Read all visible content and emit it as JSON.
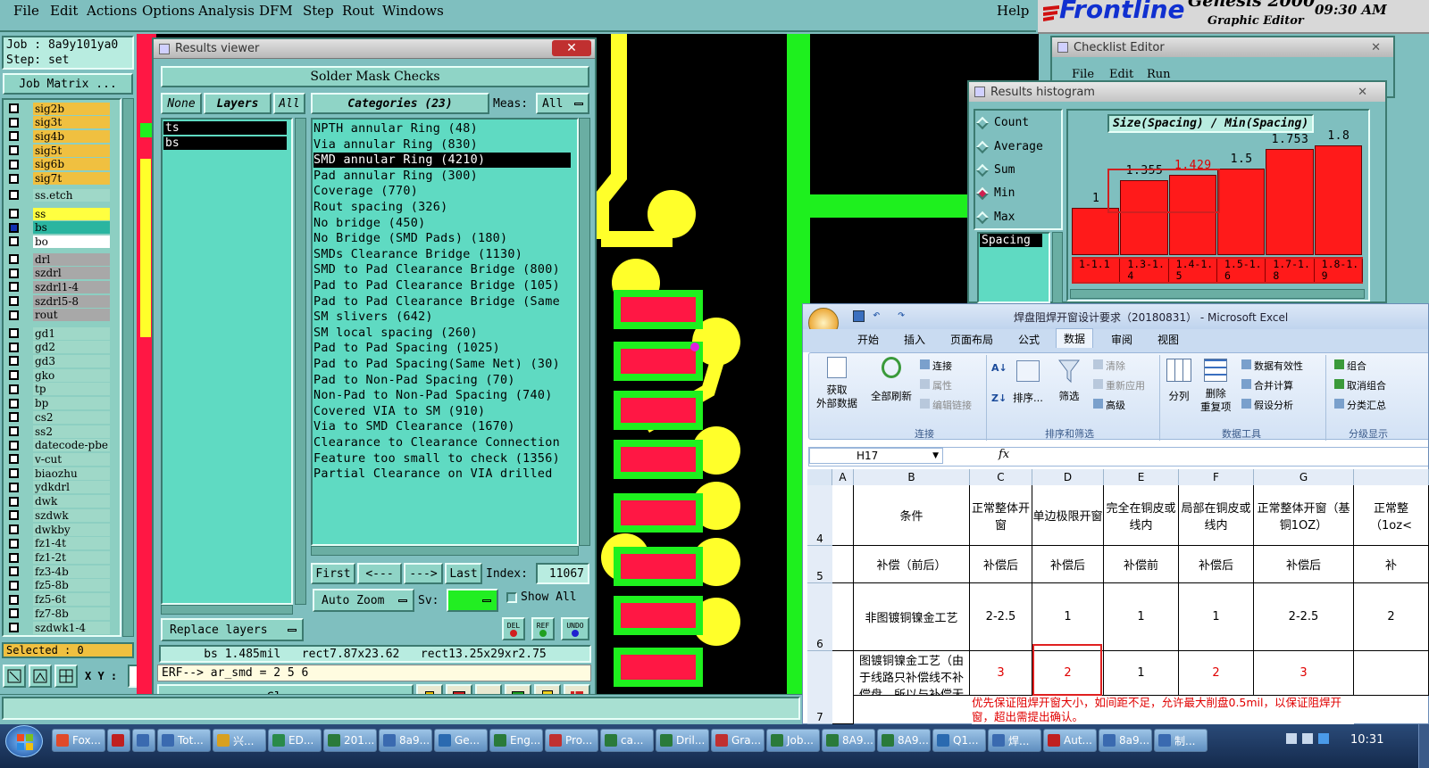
{
  "menu": {
    "items": [
      "File",
      "Edit",
      "Actions",
      "Options",
      "Analysis",
      "DFM",
      "Step",
      "Rout",
      "Windows"
    ],
    "help": "Help"
  },
  "brand": {
    "logo": "Frontline",
    "product": "Genesis 2000",
    "subtitle": "Graphic Editor",
    "clock": "09:30 AM"
  },
  "job": {
    "job_line": "Job : 8a9y101ya0",
    "step_line": "Step: set",
    "matrix_button": "Job Matrix ..."
  },
  "layers": {
    "group1": [
      {
        "name": "sig2b",
        "color": "#f0c040"
      },
      {
        "name": "sig3t",
        "color": "#f0c040"
      },
      {
        "name": "sig4b",
        "color": "#f0c040"
      },
      {
        "name": "sig5t",
        "color": "#f0c040"
      },
      {
        "name": "sig6b",
        "color": "#f0c040"
      },
      {
        "name": "sig7t",
        "color": "#f0c040"
      }
    ],
    "group2": [
      {
        "name": "ss.etch",
        "color": "#9fd8c8"
      }
    ],
    "group3": [
      {
        "name": "ss",
        "color": "#ffff40"
      },
      {
        "name": "bs",
        "color": "#2ab5a0"
      },
      {
        "name": "bo",
        "color": "#ffffff"
      }
    ],
    "group4": [
      {
        "name": "drl",
        "color": "#a8a8a8"
      },
      {
        "name": "szdrl",
        "color": "#a8a8a8"
      },
      {
        "name": "szdrl1-4",
        "color": "#a8a8a8"
      },
      {
        "name": "szdrl5-8",
        "color": "#a8a8a8"
      },
      {
        "name": "rout",
        "color": "#a8a8a8"
      }
    ],
    "group5": [
      {
        "name": "gd1",
        "color": "#9fd8c8"
      },
      {
        "name": "gd2",
        "color": "#9fd8c8"
      },
      {
        "name": "gd3",
        "color": "#9fd8c8"
      },
      {
        "name": "gko",
        "color": "#9fd8c8"
      },
      {
        "name": "tp",
        "color": "#9fd8c8"
      },
      {
        "name": "bp",
        "color": "#9fd8c8"
      },
      {
        "name": "cs2",
        "color": "#9fd8c8"
      },
      {
        "name": "ss2",
        "color": "#9fd8c8"
      },
      {
        "name": "datecode-pbe",
        "color": "#9fd8c8"
      },
      {
        "name": "v-cut",
        "color": "#9fd8c8"
      },
      {
        "name": "biaozhu",
        "color": "#9fd8c8"
      },
      {
        "name": "ydkdrl",
        "color": "#9fd8c8"
      },
      {
        "name": "dwk",
        "color": "#9fd8c8"
      },
      {
        "name": "szdwk",
        "color": "#9fd8c8"
      },
      {
        "name": "dwkby",
        "color": "#9fd8c8"
      },
      {
        "name": "fz1-4t",
        "color": "#9fd8c8"
      },
      {
        "name": "fz1-2t",
        "color": "#9fd8c8"
      },
      {
        "name": "fz3-4b",
        "color": "#9fd8c8"
      },
      {
        "name": "fz5-8b",
        "color": "#9fd8c8"
      },
      {
        "name": "fz5-6t",
        "color": "#9fd8c8"
      },
      {
        "name": "fz7-8b",
        "color": "#9fd8c8"
      },
      {
        "name": "szdwk1-4",
        "color": "#9fd8c8"
      }
    ],
    "selected": "Selected : 0",
    "xy_label": "X Y :"
  },
  "results_viewer": {
    "title": "Results viewer",
    "header": "Solder Mask Checks",
    "none_btn": "None",
    "layers_btn": "Layers",
    "all_btn": "All",
    "layer_list": [
      "ts",
      "bs"
    ],
    "categories_btn": "Categories (23)",
    "meas_label": "Meas:",
    "meas_value": "All",
    "categories": [
      "NPTH annular Ring (48)",
      "Via annular Ring (830)",
      "SMD annular Ring (4210)",
      "Pad annular Ring (300)",
      "Coverage (770)",
      "Rout spacing (326)",
      "No bridge (450)",
      "No Bridge (SMD Pads) (180)",
      "SMDs Clearance Bridge (1130)",
      "SMD to Pad Clearance Bridge (800)",
      "Pad to Pad Clearance Bridge (105)",
      "Pad to Pad Clearance Bridge (Same",
      "SM slivers (642)",
      "SM local spacing (260)",
      "Pad to Pad Spacing (1025)",
      "Pad to Pad Spacing(Same Net) (30)",
      "Pad to Non-Pad Spacing (70)",
      "Non-Pad to Non-Pad Spacing (740)",
      "Covered VIA to SM (910)",
      "Via to SMD Clearance (1670)",
      "Clearance to Clearance Connection",
      "Feature too small to check (1356)",
      "Partial Clearance on VIA drilled"
    ],
    "selected_category": "SMD annular Ring (4210)",
    "first_btn": "First",
    "prev_btn": "<---",
    "next_btn": "--->",
    "last_btn": "Last",
    "index_label": "Index:",
    "index_value": "11067",
    "auto_zoom_btn": "Auto Zoom",
    "sv_label": "Sv:",
    "show_all_label": "Show All",
    "replace_layers_btn": "Replace layers",
    "del_btn": "DEL",
    "ref_btn": "REF",
    "undo_btn": "UNDO",
    "status_text": "bs 1.485mil   rect7.87x23.62   rect13.25x29xr2.75",
    "erf_text": "ERF--> ar_smd = 2 5 6",
    "close_btn": "Close"
  },
  "checklist_editor": {
    "title": "Checklist Editor",
    "menu": [
      "File",
      "Edit",
      "Run"
    ]
  },
  "histogram": {
    "title": "Results histogram",
    "options": [
      "Count",
      "Average",
      "Sum",
      "Min",
      "Max"
    ],
    "selected_option": "Min",
    "list_item": "Spacing",
    "chart_title": "Size(Spacing) / Min(Spacing)",
    "accent": "#ff1a1a"
  },
  "chart_data": {
    "type": "bar",
    "title": "Size(Spacing) / Min(Spacing)",
    "categories": [
      "1-1.1",
      "1.3-1.4",
      "1.4-1.5",
      "1.5-1.6",
      "1.7-1.8",
      "1.8-1.9"
    ],
    "values": [
      1,
      1.355,
      1.429,
      1.5,
      1.753,
      1.8
    ],
    "value_labels": [
      "1",
      "1.355",
      "1.429",
      "1.5",
      "1.753",
      "1.8"
    ],
    "highlighted_value_label": "1.429",
    "ylim": [
      0.4,
      1.95
    ]
  },
  "excel": {
    "title": "焊盘阻焊开窗设计要求（20180831） - Microsoft Excel",
    "tabs": [
      "开始",
      "插入",
      "页面布局",
      "公式",
      "数据",
      "审阅",
      "视图"
    ],
    "active_tab": "数据",
    "groups": {
      "get_external": "获取\n外部数据",
      "refresh_all": "全部刷新",
      "conn_items": [
        "连接",
        "属性",
        "编辑链接"
      ],
      "conn_group": "连接",
      "sort": "排序...",
      "filter": "筛选",
      "filter_items": [
        "清除",
        "重新应用",
        "高级"
      ],
      "sort_group": "排序和筛选",
      "split": "分列",
      "dedupe": "删除\n重复项",
      "tool_items": [
        "数据有效性",
        "合并计算",
        "假设分析"
      ],
      "tool_group": "数据工具",
      "outline_items": [
        "组合",
        "取消组合",
        "分类汇总"
      ],
      "outline_group": "分级显示"
    },
    "name_box": "H17",
    "fx": "fx",
    "columns": [
      "A",
      "B",
      "C",
      "D",
      "E",
      "F",
      "G"
    ],
    "rows": [
      {
        "num": "4",
        "cells": [
          "条件",
          "正常整体开窗",
          "单边极限开窗",
          "完全在铜皮或线内",
          "局部在铜皮或线内",
          "正常整体开窗（基铜1OZ）",
          "正常整（1oz<"
        ]
      },
      {
        "num": "5",
        "cells": [
          "补偿（前后）",
          "补偿后",
          "补偿后",
          "补偿前",
          "补偿后",
          "补偿后",
          "补"
        ]
      },
      {
        "num": "6",
        "cells": [
          "非图镀铜镍金工艺",
          "2-2.5",
          "1",
          "1",
          "1",
          "2-2.5",
          "2"
        ]
      },
      {
        "num": "7",
        "cells": [
          "图镀铜镍金工艺（由于线路只补偿线不补偿盘，所以与补偿无关）",
          "3",
          "2",
          "1",
          "2",
          "3",
          ""
        ]
      }
    ],
    "red_note": "优先保证阻焊开窗大小，如间距不足，允许最大削盘0.5mil，以保证阻焊开窗，超出需提出确认。"
  },
  "taskbar": {
    "items": [
      "Fox...",
      "",
      "",
      "Tot...",
      "兴...",
      "ED...",
      "201...",
      "8a9...",
      "Ge...",
      "Eng...",
      "Pro...",
      "ca...",
      "Dril...",
      "Gra...",
      "Job...",
      "8A9...",
      "8A9...",
      "Q1...",
      "焊...",
      "Aut...",
      "8a9...",
      "制..."
    ],
    "clock": "10:31"
  }
}
